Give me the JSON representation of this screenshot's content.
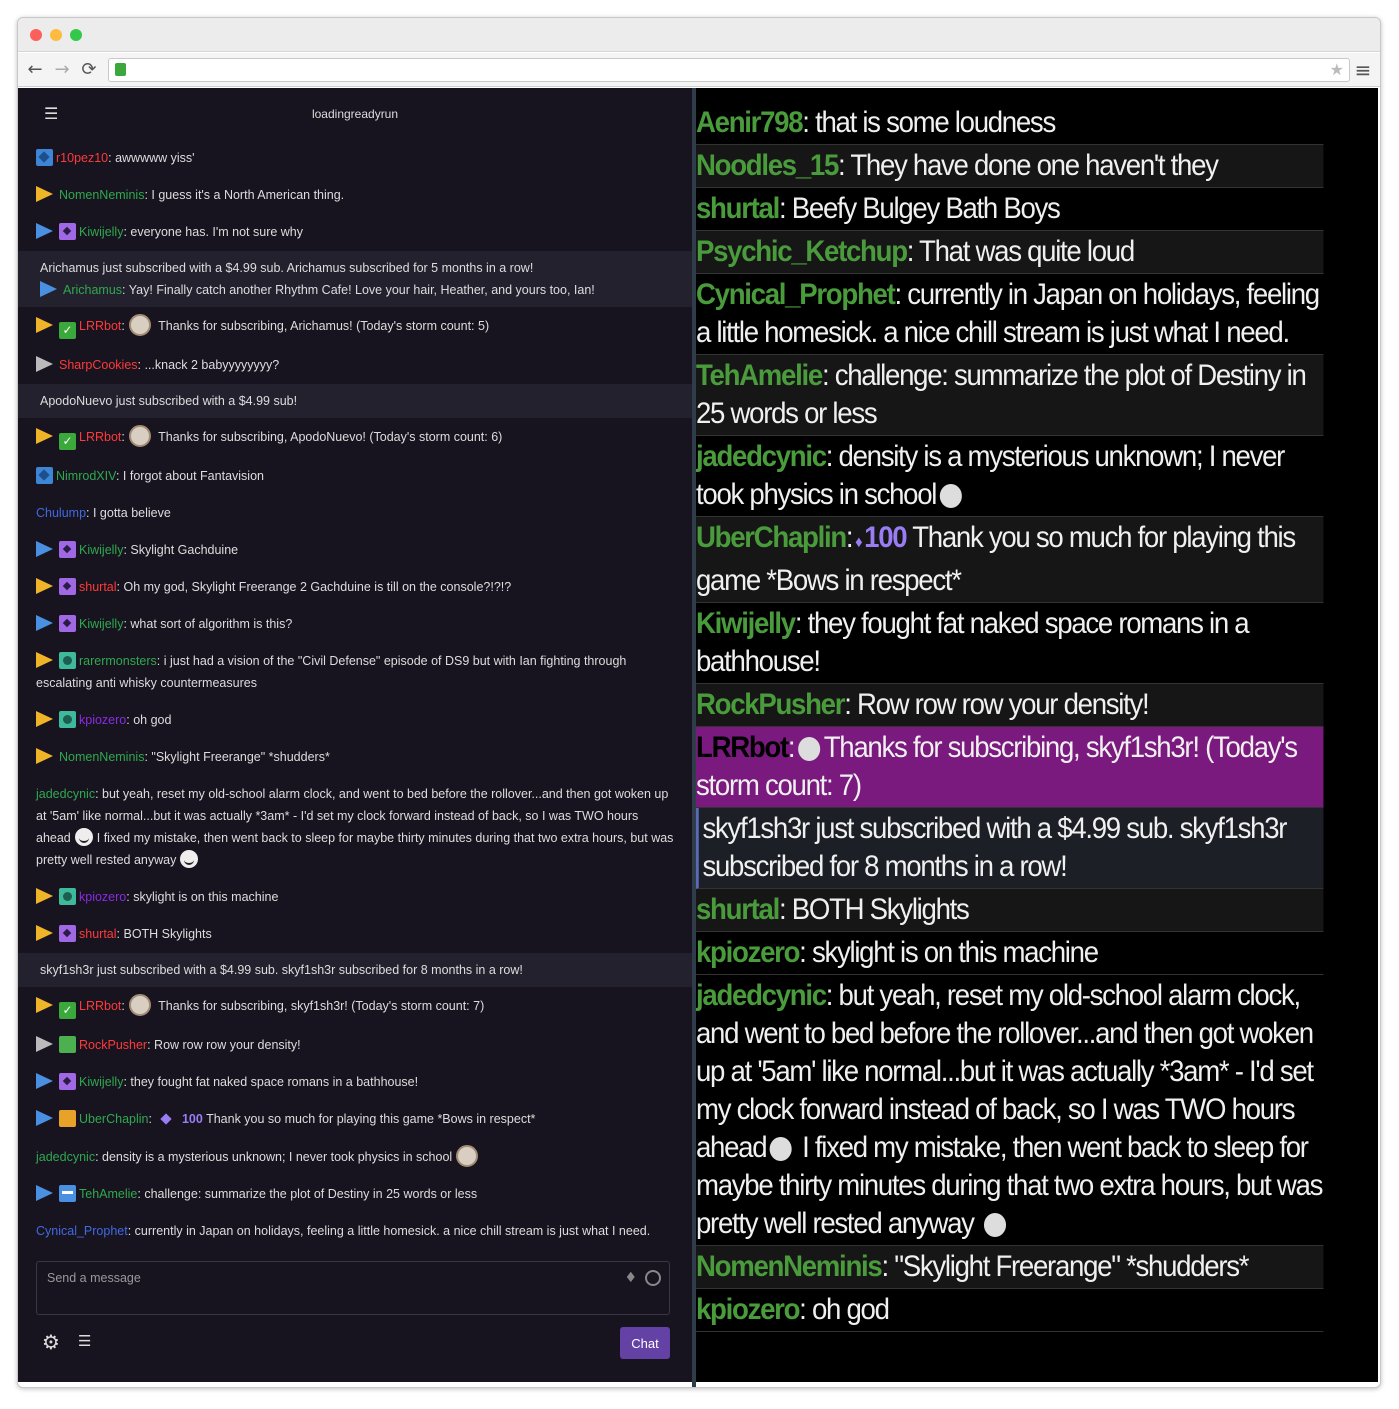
{
  "browser": {
    "controls": {
      "back": "←",
      "forward": "→",
      "reload": "⟳",
      "star": "★",
      "menu": "≡"
    }
  },
  "colors": {
    "twitch_purple": "#6441a5",
    "chat_bg": "#17141f",
    "sub_bg": "#24212e"
  },
  "left": {
    "channel": "loadingreadyrun",
    "input_placeholder": "Send a message",
    "chat_button": "Chat",
    "messages": [
      {
        "user": "r10pez10",
        "color": "#ff3a3a",
        "text": ": awwwww yiss'",
        "badges": [
          "blue"
        ]
      },
      {
        "user": "NomenNeminis",
        "color": "#2fa84f",
        "text": ": I guess it's a North American thing.",
        "chev": "#f0b429"
      },
      {
        "user": "Kiwijelly",
        "color": "#2fa84f",
        "text": ": everyone has. I'm not sure why",
        "chev": "#4a90e2",
        "badges": [
          "purple"
        ]
      },
      {
        "sub": true,
        "subtext": "Arichamus just subscribed with a $4.99 sub. Arichamus subscribed for 5 months in a row!",
        "user": "Arichamus",
        "color": "#2fa84f",
        "text": ": Yay! Finally catch another Rhythm Cafe! Love your hair, Heather, and yours too, Ian!",
        "chev": "#4a90e2"
      },
      {
        "user": "LRRbot",
        "color": "#ff3a3a",
        "text": "Thanks for subscribing, Arichamus! (Today's storm count: 5)",
        "chev": "#f0b429",
        "badges": [
          "green"
        ],
        "face": true
      },
      {
        "user": "SharpCookies",
        "color": "#ff3a3a",
        "text": ": ...knack 2 babyyyyyyyy?",
        "chev": "#bbbbbb"
      },
      {
        "sub": true,
        "subonly": true,
        "subtext": "ApodoNuevo just subscribed with a $4.99 sub!"
      },
      {
        "user": "LRRbot",
        "color": "#ff3a3a",
        "text": "Thanks for subscribing, ApodoNuevo! (Today's storm count: 6)",
        "chev": "#f0b429",
        "badges": [
          "green"
        ],
        "face": true
      },
      {
        "user": "NimrodXIV",
        "color": "#2fa84f",
        "text": ": I forgot about Fantavision",
        "badges": [
          "blue"
        ]
      },
      {
        "user": "Chulump",
        "color": "#4169e1",
        "text": ": I gotta believe"
      },
      {
        "user": "Kiwijelly",
        "color": "#2fa84f",
        "text": ": Skylight Gachduine",
        "chev": "#4a90e2",
        "badges": [
          "purple"
        ]
      },
      {
        "user": "shurtal",
        "color": "#ff3a3a",
        "text": ": Oh my god, Skylight Freerange 2 Gachduine is till on the console?!?!?",
        "chev": "#f0b429",
        "badges": [
          "purple"
        ]
      },
      {
        "user": "Kiwijelly",
        "color": "#2fa84f",
        "text": ": what sort of algorithm is this?",
        "chev": "#4a90e2",
        "badges": [
          "purple"
        ]
      },
      {
        "user": "rarermonsters",
        "color": "#2fa84f",
        "text": ": i just had a vision of the \"Civil Defense\" episode of DS9 but with Ian fighting through escalating anti whisky countermeasures",
        "chev": "#f0b429",
        "badges": [
          "teal"
        ]
      },
      {
        "user": "kpiozero",
        "color": "#8a2be2",
        "text": ": oh god",
        "chev": "#f0b429",
        "badges": [
          "teal"
        ]
      },
      {
        "user": "NomenNeminis",
        "color": "#2fa84f",
        "text": ": \"Skylight Freerange\" *shudders*",
        "chev": "#f0b429"
      },
      {
        "user": "jadedcynic",
        "color": "#2fa84f",
        "text": ": but yeah, reset my old-school alarm clock, and went to bed before the rollover...and then got woken up at '5am' like normal...but it was actually *3am* - I'd set my clock forward instead of back, so I was TWO hours ahead",
        "text2": "I fixed my mistake, then went back to sleep for maybe thirty minutes during that two extra hours, but was pretty well rested anyway",
        "smile": true
      },
      {
        "user": "kpiozero",
        "color": "#8a2be2",
        "text": ": skylight is on this machine",
        "chev": "#f0b429",
        "badges": [
          "teal"
        ]
      },
      {
        "user": "shurtal",
        "color": "#ff3a3a",
        "text": ": BOTH Skylights",
        "chev": "#f0b429",
        "badges": [
          "purple"
        ]
      },
      {
        "sub": true,
        "subonly": true,
        "subtext": "skyf1sh3r just subscribed with a $4.99 sub. skyf1sh3r subscribed for 8 months in a row!"
      },
      {
        "user": "LRRbot",
        "color": "#ff3a3a",
        "text": "Thanks for subscribing, skyf1sh3r! (Today's storm count: 7)",
        "chev": "#f0b429",
        "badges": [
          "green"
        ],
        "face": true
      },
      {
        "user": "RockPusher",
        "color": "#ff3a3a",
        "text": ": Row row row your density!",
        "chev": "#bbbbbb",
        "badges": [
          "rock"
        ]
      },
      {
        "user": "Kiwijelly",
        "color": "#2fa84f",
        "text": ": they fought fat naked space romans in a bathhouse!",
        "chev": "#4a90e2",
        "badges": [
          "purple"
        ]
      },
      {
        "user": "UberChaplin",
        "color": "#2fa84f",
        "text": ":",
        "bits": "100",
        "text_after": "Thank you so much for playing this game *Bows in respect*",
        "chev": "#4a90e2",
        "badges": [
          "orange"
        ]
      },
      {
        "user": "jadedcynic",
        "color": "#2fa84f",
        "text": ": density is a mysterious unknown; I never took physics in school",
        "face": true
      },
      {
        "user": "TehAmelie",
        "color": "#2fa84f",
        "text": ": challenge: summarize the plot of Destiny in 25 words or less",
        "chev": "#4a90e2",
        "badges": [
          "crown"
        ]
      },
      {
        "user": "Cynical_Prophet",
        "color": "#4169e1",
        "text": ": currently in Japan on holidays, feeling a little homesick. a nice chill stream is just what I need."
      },
      {
        "user": "Psychic_Ketchup",
        "color": "#4169e1",
        "text": ": That was quite loud",
        "chev": "#f0b429"
      },
      {
        "user": "shurtal",
        "color": "#ff3a3a",
        "text": ": Beefy Bulgey Bath Boys",
        "chev": "#f0b429",
        "badges": [
          "purple"
        ]
      },
      {
        "user": "Noodles_15",
        "color": "#4169e1",
        "text": ": They have done one haven't they",
        "chev": "#4a90e2",
        "badges": [
          "crown"
        ]
      },
      {
        "user": "Aenir798",
        "color": "#ff3a3a",
        "text": ": that is some loudness"
      }
    ]
  },
  "right": {
    "messages": [
      {
        "user": "Aenir798",
        "text": ": that is some loudness"
      },
      {
        "user": "Noodles_15",
        "text": ": They have done one haven't they",
        "alt": true
      },
      {
        "user": "shurtal",
        "text": ": Beefy Bulgey Bath Boys"
      },
      {
        "user": "Psychic_Ketchup",
        "text": ": That was quite loud",
        "alt": true
      },
      {
        "user": "Cynical_Prophet",
        "text": ": currently in Japan on holidays, feeling a little homesick. a nice chill stream is just what I need."
      },
      {
        "user": "TehAmelie",
        "text": ": challenge: summarize the plot of Destiny in 25 words or less",
        "alt": true
      },
      {
        "user": "jadedcynic",
        "text": ": density is a mysterious unknown; I never took physics in school",
        "face": true
      },
      {
        "user": "UberChaplin",
        "text": ":",
        "bits": "100",
        "text_after": "Thank you so much for playing this game *Bows in respect*",
        "alt": true
      },
      {
        "user": "Kiwijelly",
        "text": ": they fought fat naked space romans in a bathhouse!"
      },
      {
        "user": "RockPusher",
        "text": ": Row row row your density!",
        "alt": true
      },
      {
        "user": "LRRbot",
        "text": ":",
        "text_after": "Thanks for subscribing, skyf1sh3r! (Today's storm count: 7)",
        "lrr": true,
        "face": true
      },
      {
        "subonly": true,
        "text": "skyf1sh3r just subscribed with a $4.99 sub. skyf1sh3r subscribed for 8 months in a row!"
      },
      {
        "user": "shurtal",
        "text": ": BOTH Skylights",
        "alt": true
      },
      {
        "user": "kpiozero",
        "text": ": skylight is on this machine"
      },
      {
        "user": "jadedcynic",
        "text": ": but yeah, reset my old-school alarm clock, and went to bed before the rollover...and then got woken up at '5am' like normal...but it was actually *3am* - I'd set my clock forward instead of back, so I was TWO hours ahead",
        "text2": "I fixed my mistake, then went back to sleep for maybe thirty minutes during that two extra hours, but was pretty well rested anyway",
        "smile": true
      },
      {
        "user": "NomenNeminis",
        "text": ": \"Skylight Freerange\" *shudders*",
        "alt": true
      },
      {
        "user": "kpiozero",
        "text": ": oh god"
      }
    ]
  }
}
